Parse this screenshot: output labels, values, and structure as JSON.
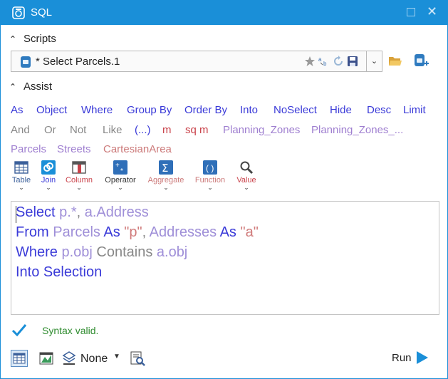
{
  "window": {
    "title": "SQL"
  },
  "scripts": {
    "header": "Scripts",
    "current": "* Select Parcels.1"
  },
  "assist": {
    "header": "Assist",
    "row1": [
      "As",
      "Object",
      "Where",
      "Group By",
      "Order By",
      "Into",
      "NoSelect",
      "Hide",
      "Desc",
      "Limit"
    ],
    "row2": [
      "And",
      "Or",
      "Not",
      "Like",
      "(...)",
      "m",
      "sq m",
      "Planning_Zones",
      "Planning_Zones_..."
    ],
    "row3": [
      "Parcels",
      "Streets",
      "CartesianArea"
    ],
    "tools": [
      "Table",
      "Join",
      "Column",
      "Operator",
      "Aggregate",
      "Function",
      "Value"
    ]
  },
  "editor": {
    "line1": {
      "k1": "Select",
      "rest1": " p.*",
      "comma": ", ",
      "rest2": "a.Address"
    },
    "line2": {
      "k1": "From",
      "id1": " Parcels ",
      "k2": "As",
      "s1": " \"p\"",
      "comma": ", ",
      "id2": "Addresses ",
      "k3": "As",
      "s2": " \"a\""
    },
    "line3": {
      "k1": "Where",
      "id1": " p.obj ",
      "p1": "Contains",
      "id2": " a.obj"
    },
    "line4": {
      "k1": "Into Selection"
    }
  },
  "status": {
    "text": "Syntax valid."
  },
  "footer": {
    "selection": "None",
    "run": "Run"
  },
  "colors": {
    "accent": "#1a8fd8",
    "keyword": "#3a3ad8",
    "valid": "#2e8b2e"
  }
}
